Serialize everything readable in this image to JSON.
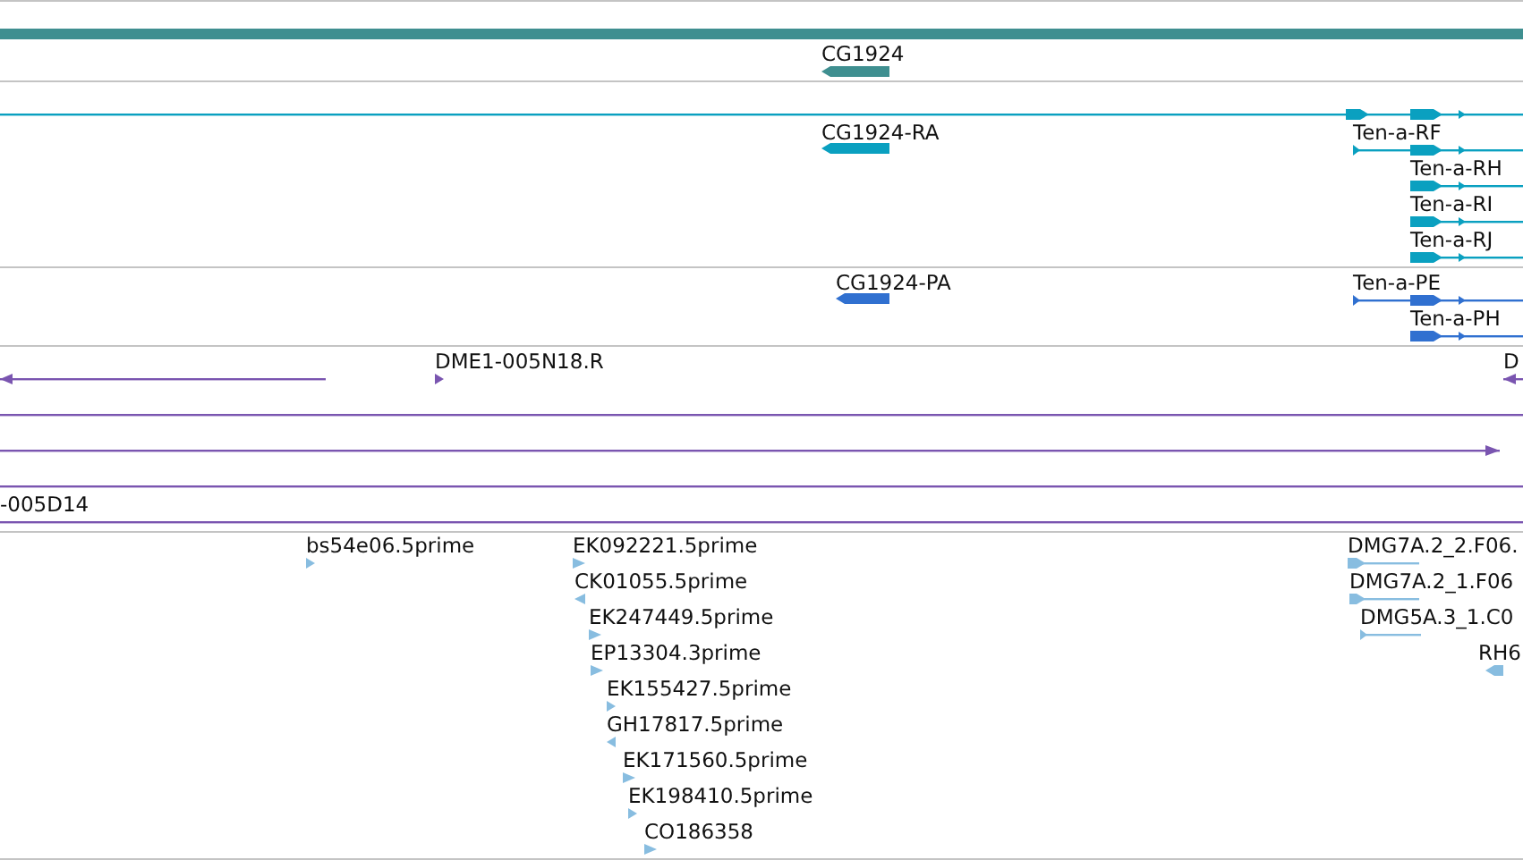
{
  "tracks": [
    {
      "kind": "gene",
      "features": [
        {
          "kind": "bar"
        },
        {
          "kind": "block",
          "label": "CG1924",
          "reverse": true
        }
      ]
    },
    {
      "kind": "transcript",
      "features": [
        {
          "kind": "line",
          "reverse": false
        },
        {
          "kind": "block",
          "label": "CG1924-RA",
          "reverse": true
        },
        {
          "kind": "line",
          "label": "Ten-a-RF",
          "reverse": false
        },
        {
          "kind": "line",
          "label": "Ten-a-RH",
          "reverse": false
        },
        {
          "kind": "line",
          "label": "Ten-a-RI",
          "reverse": false
        },
        {
          "kind": "line",
          "label": "Ten-a-RJ",
          "reverse": false
        }
      ]
    },
    {
      "kind": "protein",
      "features": [
        {
          "kind": "block",
          "label": "CG1924-PA",
          "reverse": true
        },
        {
          "kind": "line",
          "label": "Ten-a-PE",
          "reverse": false
        },
        {
          "kind": "line",
          "label": "Ten-a-PH",
          "reverse": false
        }
      ]
    },
    {
      "kind": "clone",
      "features": [
        {
          "kind": "line",
          "reverse": true
        },
        {
          "kind": "tri",
          "label": "DME1-005N18.R",
          "reverse": false
        },
        {
          "kind": "line",
          "label": "D",
          "reverse": true
        },
        {
          "kind": "line"
        },
        {
          "kind": "line",
          "reverse": false
        },
        {
          "kind": "line"
        },
        {
          "kind": "line",
          "label": "-005D14"
        }
      ]
    },
    {
      "kind": "est",
      "features": [
        {
          "kind": "tri",
          "label": "bs54e06.5prime",
          "reverse": false
        },
        {
          "kind": "tri",
          "label": "EK092221.5prime",
          "reverse": false
        },
        {
          "kind": "tri",
          "label": "CK01055.5prime",
          "reverse": true
        },
        {
          "kind": "tri",
          "label": "EK247449.5prime",
          "reverse": false
        },
        {
          "kind": "tri",
          "label": "EP13304.3prime",
          "reverse": false
        },
        {
          "kind": "tri",
          "label": "EK155427.5prime",
          "reverse": false
        },
        {
          "kind": "tri",
          "label": "GH17817.5prime",
          "reverse": true
        },
        {
          "kind": "tri",
          "label": "EK171560.5prime",
          "reverse": false
        },
        {
          "kind": "tri",
          "label": "EK198410.5prime",
          "reverse": false
        },
        {
          "kind": "tri",
          "label": "CO186358",
          "reverse": false
        },
        {
          "kind": "line",
          "label": "DMG7A.2_2.F06.",
          "reverse": false
        },
        {
          "kind": "line",
          "label": "DMG7A.2_1.F06",
          "reverse": false
        },
        {
          "kind": "line",
          "label": "DMG5A.3_1.C0",
          "reverse": false
        },
        {
          "kind": "block",
          "label": "RH6",
          "reverse": true
        }
      ]
    }
  ]
}
